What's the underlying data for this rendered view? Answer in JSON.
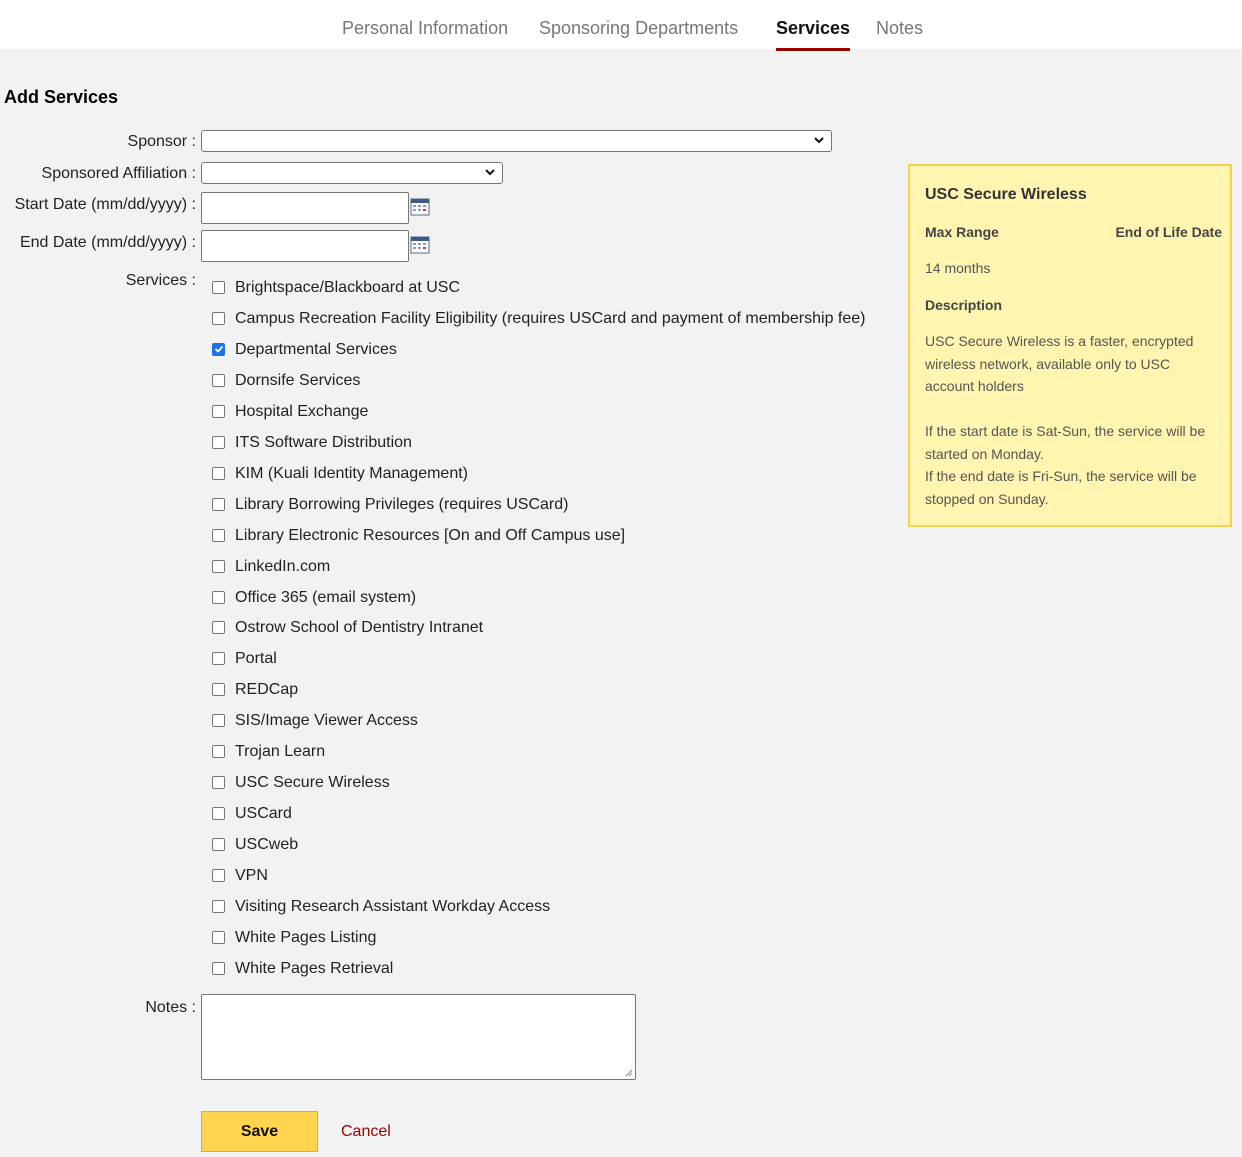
{
  "tabs": [
    {
      "label": "Personal Information",
      "active": false
    },
    {
      "label": "Sponsoring Departments",
      "active": false
    },
    {
      "label": "Services",
      "active": true
    },
    {
      "label": "Notes",
      "active": false
    }
  ],
  "form": {
    "section_title": "Add Services",
    "sponsor_label": "Sponsor :",
    "sponsor_value": "",
    "affiliation_label": "Sponsored Affiliation :",
    "affiliation_value": "",
    "start_date_label": "Start Date (mm/dd/yyyy) :",
    "start_date_value": "",
    "end_date_label": "End Date (mm/dd/yyyy) :",
    "end_date_value": "",
    "services_label": "Services :",
    "notes_label": "Notes :",
    "notes_value": ""
  },
  "services": [
    {
      "label": "Brightspace/Blackboard at USC",
      "checked": false
    },
    {
      "label": "Campus Recreation Facility Eligibility (requires USCard and payment of membership fee)",
      "checked": false
    },
    {
      "label": "Departmental Services",
      "checked": true
    },
    {
      "label": "Dornsife Services",
      "checked": false
    },
    {
      "label": "Hospital Exchange",
      "checked": false
    },
    {
      "label": "ITS Software Distribution",
      "checked": false
    },
    {
      "label": "KIM (Kuali Identity Management)",
      "checked": false
    },
    {
      "label": "Library Borrowing Privileges (requires USCard)",
      "checked": false
    },
    {
      "label": "Library Electronic Resources [On and Off Campus use]",
      "checked": false
    },
    {
      "label": "LinkedIn.com",
      "checked": false
    },
    {
      "label": "Office 365 (email system)",
      "checked": false
    },
    {
      "label": "Ostrow School of Dentistry Intranet",
      "checked": false
    },
    {
      "label": "Portal",
      "checked": false
    },
    {
      "label": "REDCap",
      "checked": false
    },
    {
      "label": "SIS/Image Viewer Access",
      "checked": false
    },
    {
      "label": "Trojan Learn",
      "checked": false
    },
    {
      "label": "USC Secure Wireless",
      "checked": false
    },
    {
      "label": "USCard",
      "checked": false
    },
    {
      "label": "USCweb",
      "checked": false
    },
    {
      "label": "VPN",
      "checked": false
    },
    {
      "label": "Visiting Research Assistant Workday Access",
      "checked": false
    },
    {
      "label": "White Pages Listing",
      "checked": false
    },
    {
      "label": "White Pages Retrieval",
      "checked": false
    }
  ],
  "actions": {
    "save_label": "Save",
    "cancel_label": "Cancel"
  },
  "info": {
    "title": "USC Secure Wireless",
    "max_range_label": "Max Range",
    "eol_label": "End of Life Date",
    "max_range_value": "14 months",
    "description_label": "Description",
    "description_lines": [
      "USC Secure Wireless is a faster, encrypted",
      "wireless network, available only to USC",
      "account holders"
    ],
    "note_lines": [
      "If the start date is Sat-Sun, the service will be",
      "started on Monday.",
      "If the end date is Fri-Sun, the service will be",
      "stopped on Sunday."
    ]
  },
  "colors": {
    "accent": "#9a0000",
    "save_button": "#ffd54f",
    "info_bg": "#fff5b0",
    "info_border": "#f3d354",
    "checkbox_checked": "#1a73e8"
  },
  "icons": {
    "calendar": "calendar-icon",
    "select": "chevron-down-icon",
    "check": "checkmark-icon"
  }
}
